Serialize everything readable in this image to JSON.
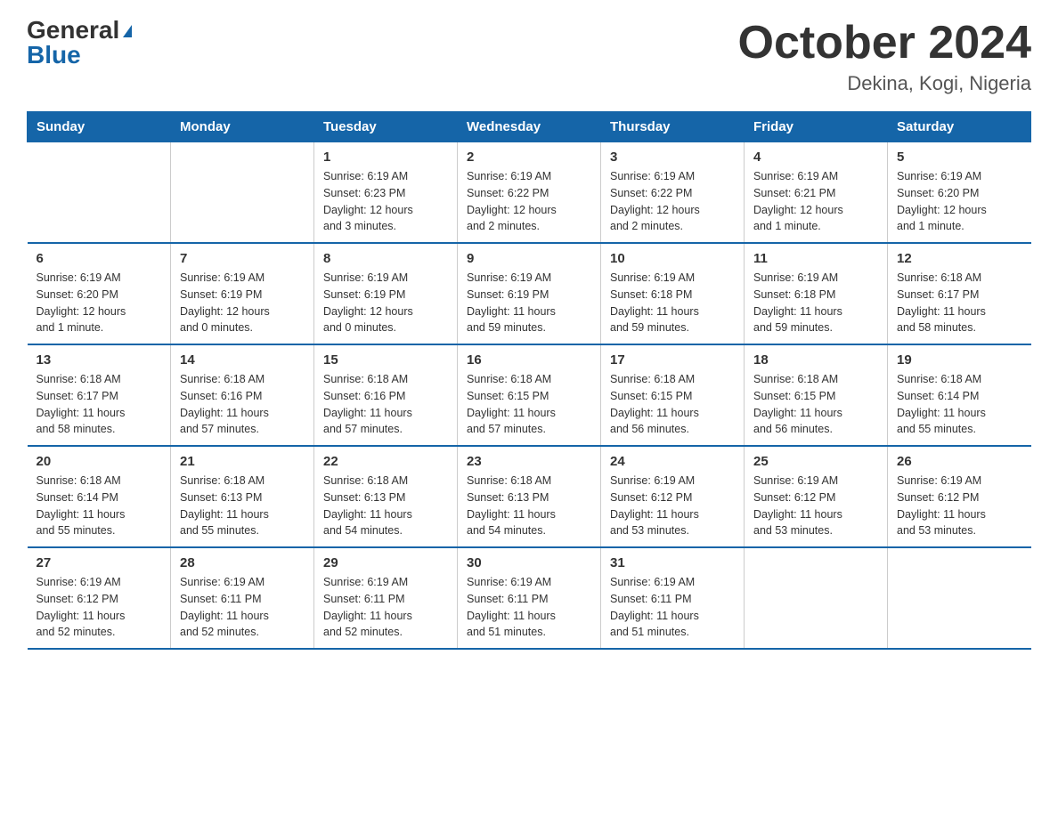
{
  "logo": {
    "general": "General",
    "blue": "Blue"
  },
  "title": "October 2024",
  "location": "Dekina, Kogi, Nigeria",
  "days_of_week": [
    "Sunday",
    "Monday",
    "Tuesday",
    "Wednesday",
    "Thursday",
    "Friday",
    "Saturday"
  ],
  "weeks": [
    [
      {
        "day": "",
        "info": ""
      },
      {
        "day": "",
        "info": ""
      },
      {
        "day": "1",
        "info": "Sunrise: 6:19 AM\nSunset: 6:23 PM\nDaylight: 12 hours\nand 3 minutes."
      },
      {
        "day": "2",
        "info": "Sunrise: 6:19 AM\nSunset: 6:22 PM\nDaylight: 12 hours\nand 2 minutes."
      },
      {
        "day": "3",
        "info": "Sunrise: 6:19 AM\nSunset: 6:22 PM\nDaylight: 12 hours\nand 2 minutes."
      },
      {
        "day": "4",
        "info": "Sunrise: 6:19 AM\nSunset: 6:21 PM\nDaylight: 12 hours\nand 1 minute."
      },
      {
        "day": "5",
        "info": "Sunrise: 6:19 AM\nSunset: 6:20 PM\nDaylight: 12 hours\nand 1 minute."
      }
    ],
    [
      {
        "day": "6",
        "info": "Sunrise: 6:19 AM\nSunset: 6:20 PM\nDaylight: 12 hours\nand 1 minute."
      },
      {
        "day": "7",
        "info": "Sunrise: 6:19 AM\nSunset: 6:19 PM\nDaylight: 12 hours\nand 0 minutes."
      },
      {
        "day": "8",
        "info": "Sunrise: 6:19 AM\nSunset: 6:19 PM\nDaylight: 12 hours\nand 0 minutes."
      },
      {
        "day": "9",
        "info": "Sunrise: 6:19 AM\nSunset: 6:19 PM\nDaylight: 11 hours\nand 59 minutes."
      },
      {
        "day": "10",
        "info": "Sunrise: 6:19 AM\nSunset: 6:18 PM\nDaylight: 11 hours\nand 59 minutes."
      },
      {
        "day": "11",
        "info": "Sunrise: 6:19 AM\nSunset: 6:18 PM\nDaylight: 11 hours\nand 59 minutes."
      },
      {
        "day": "12",
        "info": "Sunrise: 6:18 AM\nSunset: 6:17 PM\nDaylight: 11 hours\nand 58 minutes."
      }
    ],
    [
      {
        "day": "13",
        "info": "Sunrise: 6:18 AM\nSunset: 6:17 PM\nDaylight: 11 hours\nand 58 minutes."
      },
      {
        "day": "14",
        "info": "Sunrise: 6:18 AM\nSunset: 6:16 PM\nDaylight: 11 hours\nand 57 minutes."
      },
      {
        "day": "15",
        "info": "Sunrise: 6:18 AM\nSunset: 6:16 PM\nDaylight: 11 hours\nand 57 minutes."
      },
      {
        "day": "16",
        "info": "Sunrise: 6:18 AM\nSunset: 6:15 PM\nDaylight: 11 hours\nand 57 minutes."
      },
      {
        "day": "17",
        "info": "Sunrise: 6:18 AM\nSunset: 6:15 PM\nDaylight: 11 hours\nand 56 minutes."
      },
      {
        "day": "18",
        "info": "Sunrise: 6:18 AM\nSunset: 6:15 PM\nDaylight: 11 hours\nand 56 minutes."
      },
      {
        "day": "19",
        "info": "Sunrise: 6:18 AM\nSunset: 6:14 PM\nDaylight: 11 hours\nand 55 minutes."
      }
    ],
    [
      {
        "day": "20",
        "info": "Sunrise: 6:18 AM\nSunset: 6:14 PM\nDaylight: 11 hours\nand 55 minutes."
      },
      {
        "day": "21",
        "info": "Sunrise: 6:18 AM\nSunset: 6:13 PM\nDaylight: 11 hours\nand 55 minutes."
      },
      {
        "day": "22",
        "info": "Sunrise: 6:18 AM\nSunset: 6:13 PM\nDaylight: 11 hours\nand 54 minutes."
      },
      {
        "day": "23",
        "info": "Sunrise: 6:18 AM\nSunset: 6:13 PM\nDaylight: 11 hours\nand 54 minutes."
      },
      {
        "day": "24",
        "info": "Sunrise: 6:19 AM\nSunset: 6:12 PM\nDaylight: 11 hours\nand 53 minutes."
      },
      {
        "day": "25",
        "info": "Sunrise: 6:19 AM\nSunset: 6:12 PM\nDaylight: 11 hours\nand 53 minutes."
      },
      {
        "day": "26",
        "info": "Sunrise: 6:19 AM\nSunset: 6:12 PM\nDaylight: 11 hours\nand 53 minutes."
      }
    ],
    [
      {
        "day": "27",
        "info": "Sunrise: 6:19 AM\nSunset: 6:12 PM\nDaylight: 11 hours\nand 52 minutes."
      },
      {
        "day": "28",
        "info": "Sunrise: 6:19 AM\nSunset: 6:11 PM\nDaylight: 11 hours\nand 52 minutes."
      },
      {
        "day": "29",
        "info": "Sunrise: 6:19 AM\nSunset: 6:11 PM\nDaylight: 11 hours\nand 52 minutes."
      },
      {
        "day": "30",
        "info": "Sunrise: 6:19 AM\nSunset: 6:11 PM\nDaylight: 11 hours\nand 51 minutes."
      },
      {
        "day": "31",
        "info": "Sunrise: 6:19 AM\nSunset: 6:11 PM\nDaylight: 11 hours\nand 51 minutes."
      },
      {
        "day": "",
        "info": ""
      },
      {
        "day": "",
        "info": ""
      }
    ]
  ]
}
